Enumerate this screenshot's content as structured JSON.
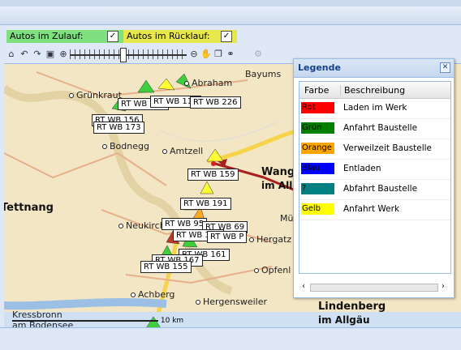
{
  "filters": {
    "zulauf_label": "Autos im Zulauf:",
    "zulauf_checked": "✓",
    "ruecklauf_label": "Autos im Rücklauf:",
    "ruecklauf_checked": "✓",
    "zulauf_color": "#7ee07e",
    "ruecklauf_color": "#e8e84c"
  },
  "toolbar": {
    "icons": [
      "home-icon",
      "undo-icon",
      "redo-icon",
      "zoom-extent-icon",
      "zoom-in-icon",
      "zoom-out-icon",
      "pan-hand-icon",
      "layers-icon",
      "binoculars-icon",
      "settings-gear-icon"
    ]
  },
  "map": {
    "places": [
      {
        "name": "Bayums",
        "big": false,
        "dot": false
      },
      {
        "name": "Abraham",
        "big": false,
        "dot": true
      },
      {
        "name": "Grünkraut",
        "big": false,
        "dot": true
      },
      {
        "name": "Bodnegg",
        "big": false,
        "dot": true
      },
      {
        "name": "Amtzell",
        "big": false,
        "dot": true
      },
      {
        "name": "Wang",
        "big": true,
        "dot": false
      },
      {
        "name": "im Allgäu",
        "big": true,
        "dot": false
      },
      {
        "name": "Tettnang",
        "big": true,
        "dot": false
      },
      {
        "name": "Neukirch",
        "big": false,
        "dot": true
      },
      {
        "name": "Mü",
        "big": false,
        "dot": false
      },
      {
        "name": "Hergatz",
        "big": false,
        "dot": true
      },
      {
        "name": "Opfenl",
        "big": false,
        "dot": true
      },
      {
        "name": "Achberg",
        "big": false,
        "dot": true
      },
      {
        "name": "Hergensweiler",
        "big": false,
        "dot": true
      },
      {
        "name": "Lindenberg",
        "big": true,
        "dot": false
      },
      {
        "name": "im Allgäu",
        "big": true,
        "dot": false
      },
      {
        "name": "Kressbronn",
        "big": false,
        "dot": false
      },
      {
        "name": "am Bodensee",
        "big": false,
        "dot": false
      }
    ],
    "vehicles": [
      "RT WB 157",
      "RT WB 110",
      "RT WB 226",
      "RT WB 156",
      "RT WB 173",
      "RT WB 159",
      "RT WB 191",
      "RT WB 95",
      "RT WB 69",
      "RT WB 147",
      "RT WB P",
      "RT WB 161",
      "RT WB 167",
      "RT WB 155"
    ],
    "scale_label": "10 km"
  },
  "legend": {
    "title": "Legende",
    "close_icon": "close-icon",
    "col_color": "Farbe",
    "col_desc": "Beschreibung",
    "rows": [
      {
        "color": "Rot",
        "hex": "#ff0000",
        "text_color": "#000000",
        "desc": "Laden im Werk"
      },
      {
        "color": "Grün",
        "hex": "#008000",
        "text_color": "#000000",
        "desc": "Anfahrt Baustelle"
      },
      {
        "color": "Orange",
        "hex": "#ffa500",
        "text_color": "#000000",
        "desc": "Verweilzeit Baustelle"
      },
      {
        "color": "Blau",
        "hex": "#0000ff",
        "text_color": "#000000",
        "desc": "Entladen"
      },
      {
        "color": "?",
        "hex": "#008080",
        "text_color": "#000000",
        "desc": "Abfahrt Baustelle"
      },
      {
        "color": "Gelb",
        "hex": "#ffff00",
        "text_color": "#000000",
        "desc": "Anfahrt Werk"
      }
    ]
  }
}
